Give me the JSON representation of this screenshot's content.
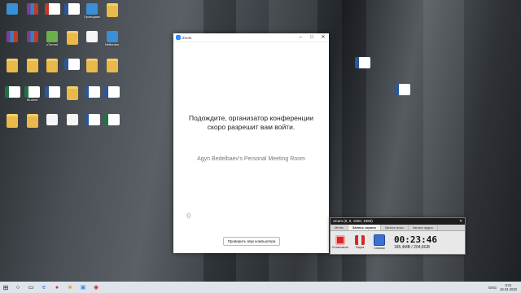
{
  "zoom": {
    "title": "Zoom",
    "minimize": "–",
    "maximize": "□",
    "close": "✕",
    "message_line1": "Подождите, организатор конференции",
    "message_line2": "скоро разрешит вам войти.",
    "room_name": "Agyn Bedelbaev's Personal Meeting Room",
    "test_audio_button": "Проверить звук компьютера"
  },
  "ocam": {
    "title": "oCam (0, 0, 1920, 1080)",
    "tabs": [
      "Меню",
      "Запись экрана",
      "Запись игры",
      "Запись аудио"
    ],
    "tools": [
      {
        "label": "Остановить",
        "icon": "stop-icon"
      },
      {
        "label": "Пауза",
        "icon": "pause-icon"
      },
      {
        "label": "Снимок",
        "icon": "screen-icon"
      }
    ],
    "elapsed_time": "00:23:46",
    "size": "185,4MB / 204,8GB"
  },
  "desktop": {
    "icons": [
      {
        "label": "",
        "type": "app"
      },
      {
        "label": "",
        "type": "rar"
      },
      {
        "label": "",
        "type": "pdf"
      },
      {
        "label": "",
        "type": "word"
      },
      {
        "label": "Проводник",
        "type": "app"
      },
      {
        "label": "",
        "type": "folder"
      },
      {
        "label": "",
        "type": "rar"
      },
      {
        "label": "",
        "type": "rar"
      },
      {
        "label": "uTorrent",
        "type": "green"
      },
      {
        "label": "",
        "type": "folder"
      },
      {
        "label": "",
        "type": "doc"
      },
      {
        "label": "Netbeans",
        "type": "app"
      },
      {
        "label": "",
        "type": "folder"
      },
      {
        "label": "",
        "type": "folder"
      },
      {
        "label": "",
        "type": "folder"
      },
      {
        "label": "",
        "type": "word"
      },
      {
        "label": "",
        "type": "folder"
      },
      {
        "label": "",
        "type": "folder"
      },
      {
        "label": "",
        "type": "excel"
      },
      {
        "label": "Student",
        "type": "excel"
      },
      {
        "label": "",
        "type": "word"
      },
      {
        "label": "",
        "type": "folder"
      },
      {
        "label": "",
        "type": "word"
      },
      {
        "label": "",
        "type": "word"
      },
      {
        "label": "",
        "type": "folder"
      },
      {
        "label": "",
        "type": "folder"
      },
      {
        "label": "",
        "type": "doc"
      },
      {
        "label": "",
        "type": "doc"
      },
      {
        "label": "",
        "type": "word"
      },
      {
        "label": "",
        "type": "excel"
      }
    ],
    "right_icons": [
      {
        "label": "",
        "type": "word"
      },
      {
        "label": "",
        "type": "word"
      }
    ]
  },
  "taskbar": {
    "start_icon": "windows-icon",
    "language": "ENG",
    "time": "8:21",
    "date": "16.04.2020"
  }
}
